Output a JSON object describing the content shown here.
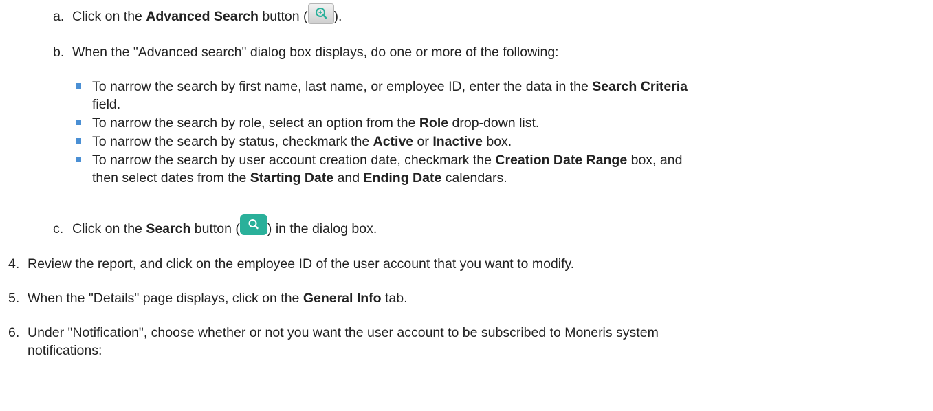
{
  "colors": {
    "bullet": "#4a8fd4",
    "search_button": "#2ab09a",
    "text": "#222222"
  },
  "steps": {
    "a": {
      "marker": "a.",
      "t1": "Click on the ",
      "b1": "Advanced Search",
      "t2": " button (",
      "icon": "advanced-search-icon",
      "t3": ")."
    },
    "b": {
      "marker": "b.",
      "t1": "When the \"Advanced search\" dialog box displays, do one or more of the following:"
    },
    "bullets": [
      {
        "l1_t1": "To narrow the search by first name, last name, or employee ID, enter the data in the ",
        "l1_b1": "Search Criteria",
        "l2_t1": "field."
      },
      {
        "t1": "To narrow the search by role, select an option from the ",
        "b1": "Role",
        "t2": " drop-down list."
      },
      {
        "t1": "To narrow the search by status, checkmark the ",
        "b1": "Active",
        "t2": " or ",
        "b2": "Inactive",
        "t3": " box."
      },
      {
        "l1_t1": "To narrow the search by user account creation date, checkmark the ",
        "l1_b1": "Creation Date Range",
        "l1_t2": " box, and",
        "l2_t1": "then select dates from the ",
        "l2_b1": "Starting Date",
        "l2_t2": " and ",
        "l2_b2": "Ending Date",
        "l2_t3": " calendars."
      }
    ],
    "c": {
      "marker": "c.",
      "t1": "Click on the ",
      "b1": "Search",
      "t2": " button (",
      "icon": "search-icon",
      "t3": ") in the dialog box."
    },
    "s4": {
      "marker": "4.",
      "t1": "Review the report, and click on the employee ID of the user account that you want to modify."
    },
    "s5": {
      "marker": "5.",
      "t1": "When the \"Details\" page displays, click on the ",
      "b1": "General Info",
      "t2": " tab."
    },
    "s6": {
      "marker": "6.",
      "l1": "Under \"Notification\", choose whether or not you want the user account to be subscribed to Moneris system",
      "l2": "notifications:"
    }
  }
}
